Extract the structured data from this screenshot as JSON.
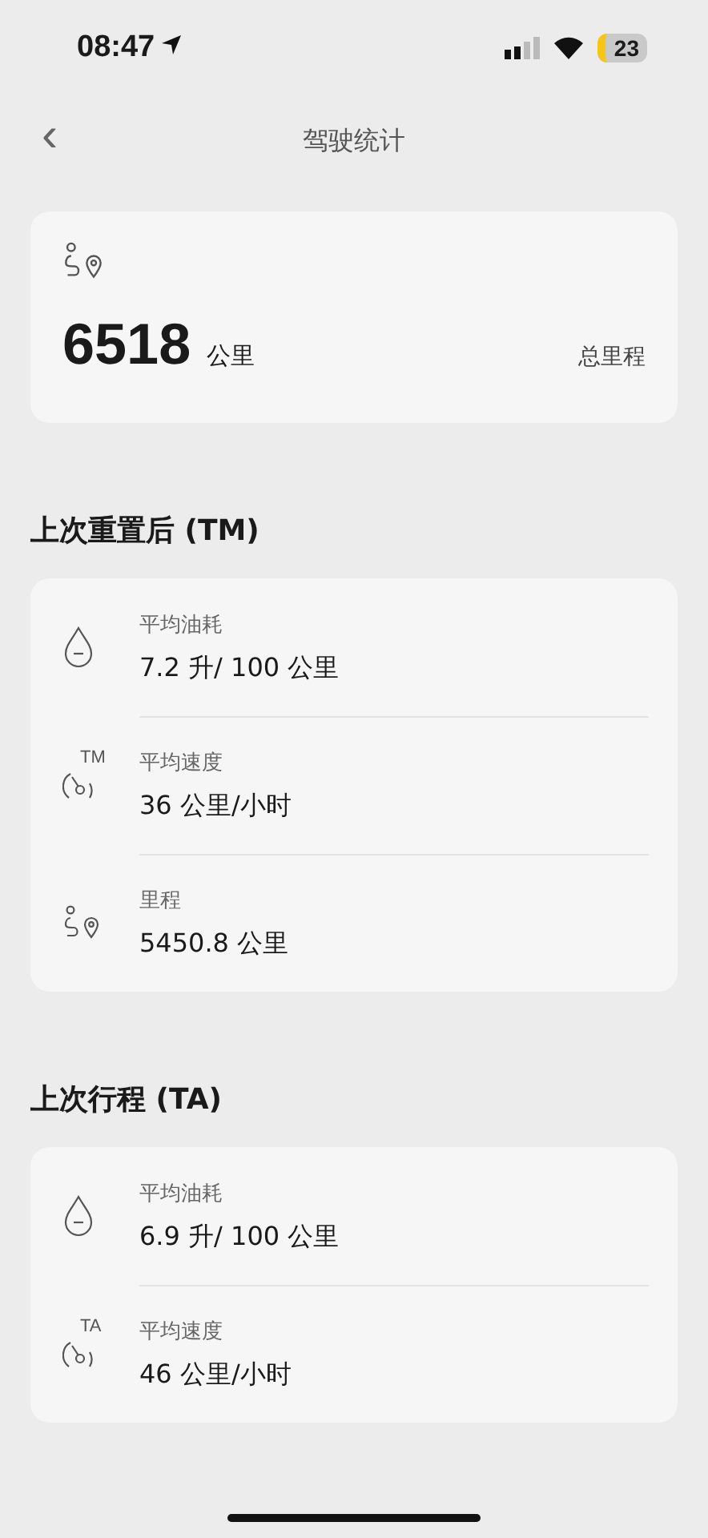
{
  "status_bar": {
    "time": "08:47",
    "battery": "23"
  },
  "nav": {
    "back": "‹",
    "title": "驾驶统计"
  },
  "total": {
    "value": "6518",
    "unit": "公里",
    "label": "总里程"
  },
  "sections": [
    {
      "title": "上次重置后 (TM)",
      "items": [
        {
          "kind": "fuel",
          "label": "平均油耗",
          "value": "7.2 升/ 100 公里"
        },
        {
          "kind": "speed",
          "badge": "TM",
          "label": "平均速度",
          "value": "36 公里/小时"
        },
        {
          "kind": "distance",
          "label": "里程",
          "value": "5450.8 公里"
        }
      ]
    },
    {
      "title": "上次行程 (TA)",
      "items": [
        {
          "kind": "fuel",
          "label": "平均油耗",
          "value": "6.9 升/ 100 公里"
        },
        {
          "kind": "speed",
          "badge": "TA",
          "label": "平均速度",
          "value": "46 公里/小时"
        }
      ]
    }
  ]
}
